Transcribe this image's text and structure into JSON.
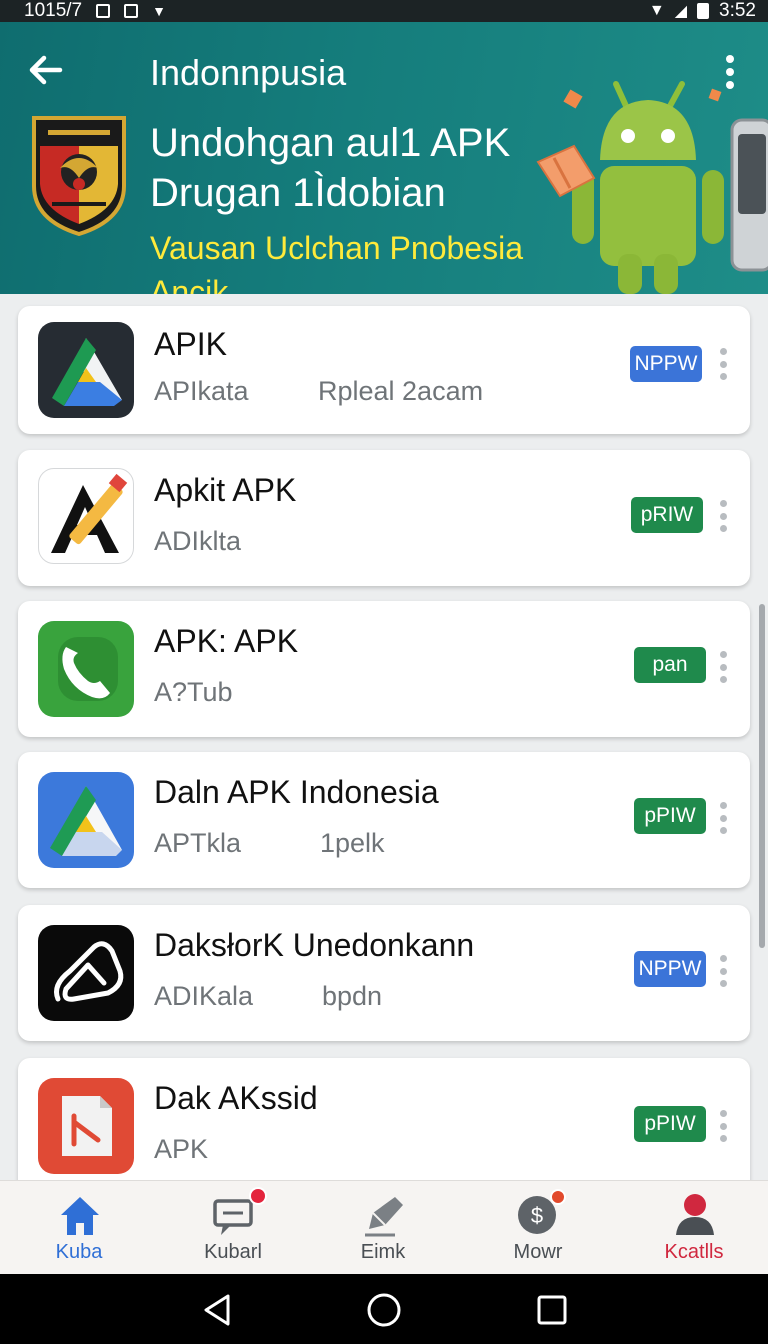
{
  "status": {
    "time_left": "1015/7",
    "time_right": "3:52"
  },
  "header": {
    "title": "Indonnpusia",
    "headline_line1": "Undohgan aul1 APK",
    "headline_line2": "Drugan 1Ìdobian",
    "subline": "Vausan Uclchan Pnobesia Ancik"
  },
  "apps": [
    {
      "title": "APIK",
      "subtitle": "APIkata",
      "extra": "Rpleal 2acam",
      "badge": "NPPW",
      "badge_color": "#3b74d8",
      "icon": "drive-like-icon"
    },
    {
      "title": "Apkit APK",
      "subtitle": "ADIklta",
      "extra": "",
      "badge": "pRIW",
      "badge_color": "#1f8a4c",
      "icon": "pencil-a-icon"
    },
    {
      "title": "APK: APK",
      "subtitle": "A?Tub",
      "extra": "",
      "badge": "pan",
      "badge_color": "#1f8a4c",
      "icon": "phone-icon"
    },
    {
      "title": "Daln APK Indonesia",
      "subtitle": "APTkla",
      "extra": "1pelk",
      "badge": "pPIW",
      "badge_color": "#1f8a4c",
      "icon": "triangle-icon"
    },
    {
      "title": "DaksłorK Unedonkann",
      "subtitle": "ADIKala",
      "extra": "bpdn",
      "badge": "NPPW",
      "badge_color": "#3b74d8",
      "icon": "a-logo-icon"
    },
    {
      "title": "Dak AKssid",
      "subtitle": "APK",
      "extra": "",
      "badge": "pPIW",
      "badge_color": "#1f8a4c",
      "icon": "document-icon"
    }
  ],
  "nav": [
    {
      "label": "Kuba",
      "active": true
    },
    {
      "label": "Kubarl",
      "active": false
    },
    {
      "label": "Eimk",
      "active": false
    },
    {
      "label": "Mowr",
      "active": false
    },
    {
      "label": "Kcatlls",
      "active": false
    }
  ],
  "colors": {
    "header": "#157d7c",
    "accent_yellow": "#ffea3b",
    "nav_active": "#2f6fd6",
    "nav_alert": "#d0283f"
  }
}
